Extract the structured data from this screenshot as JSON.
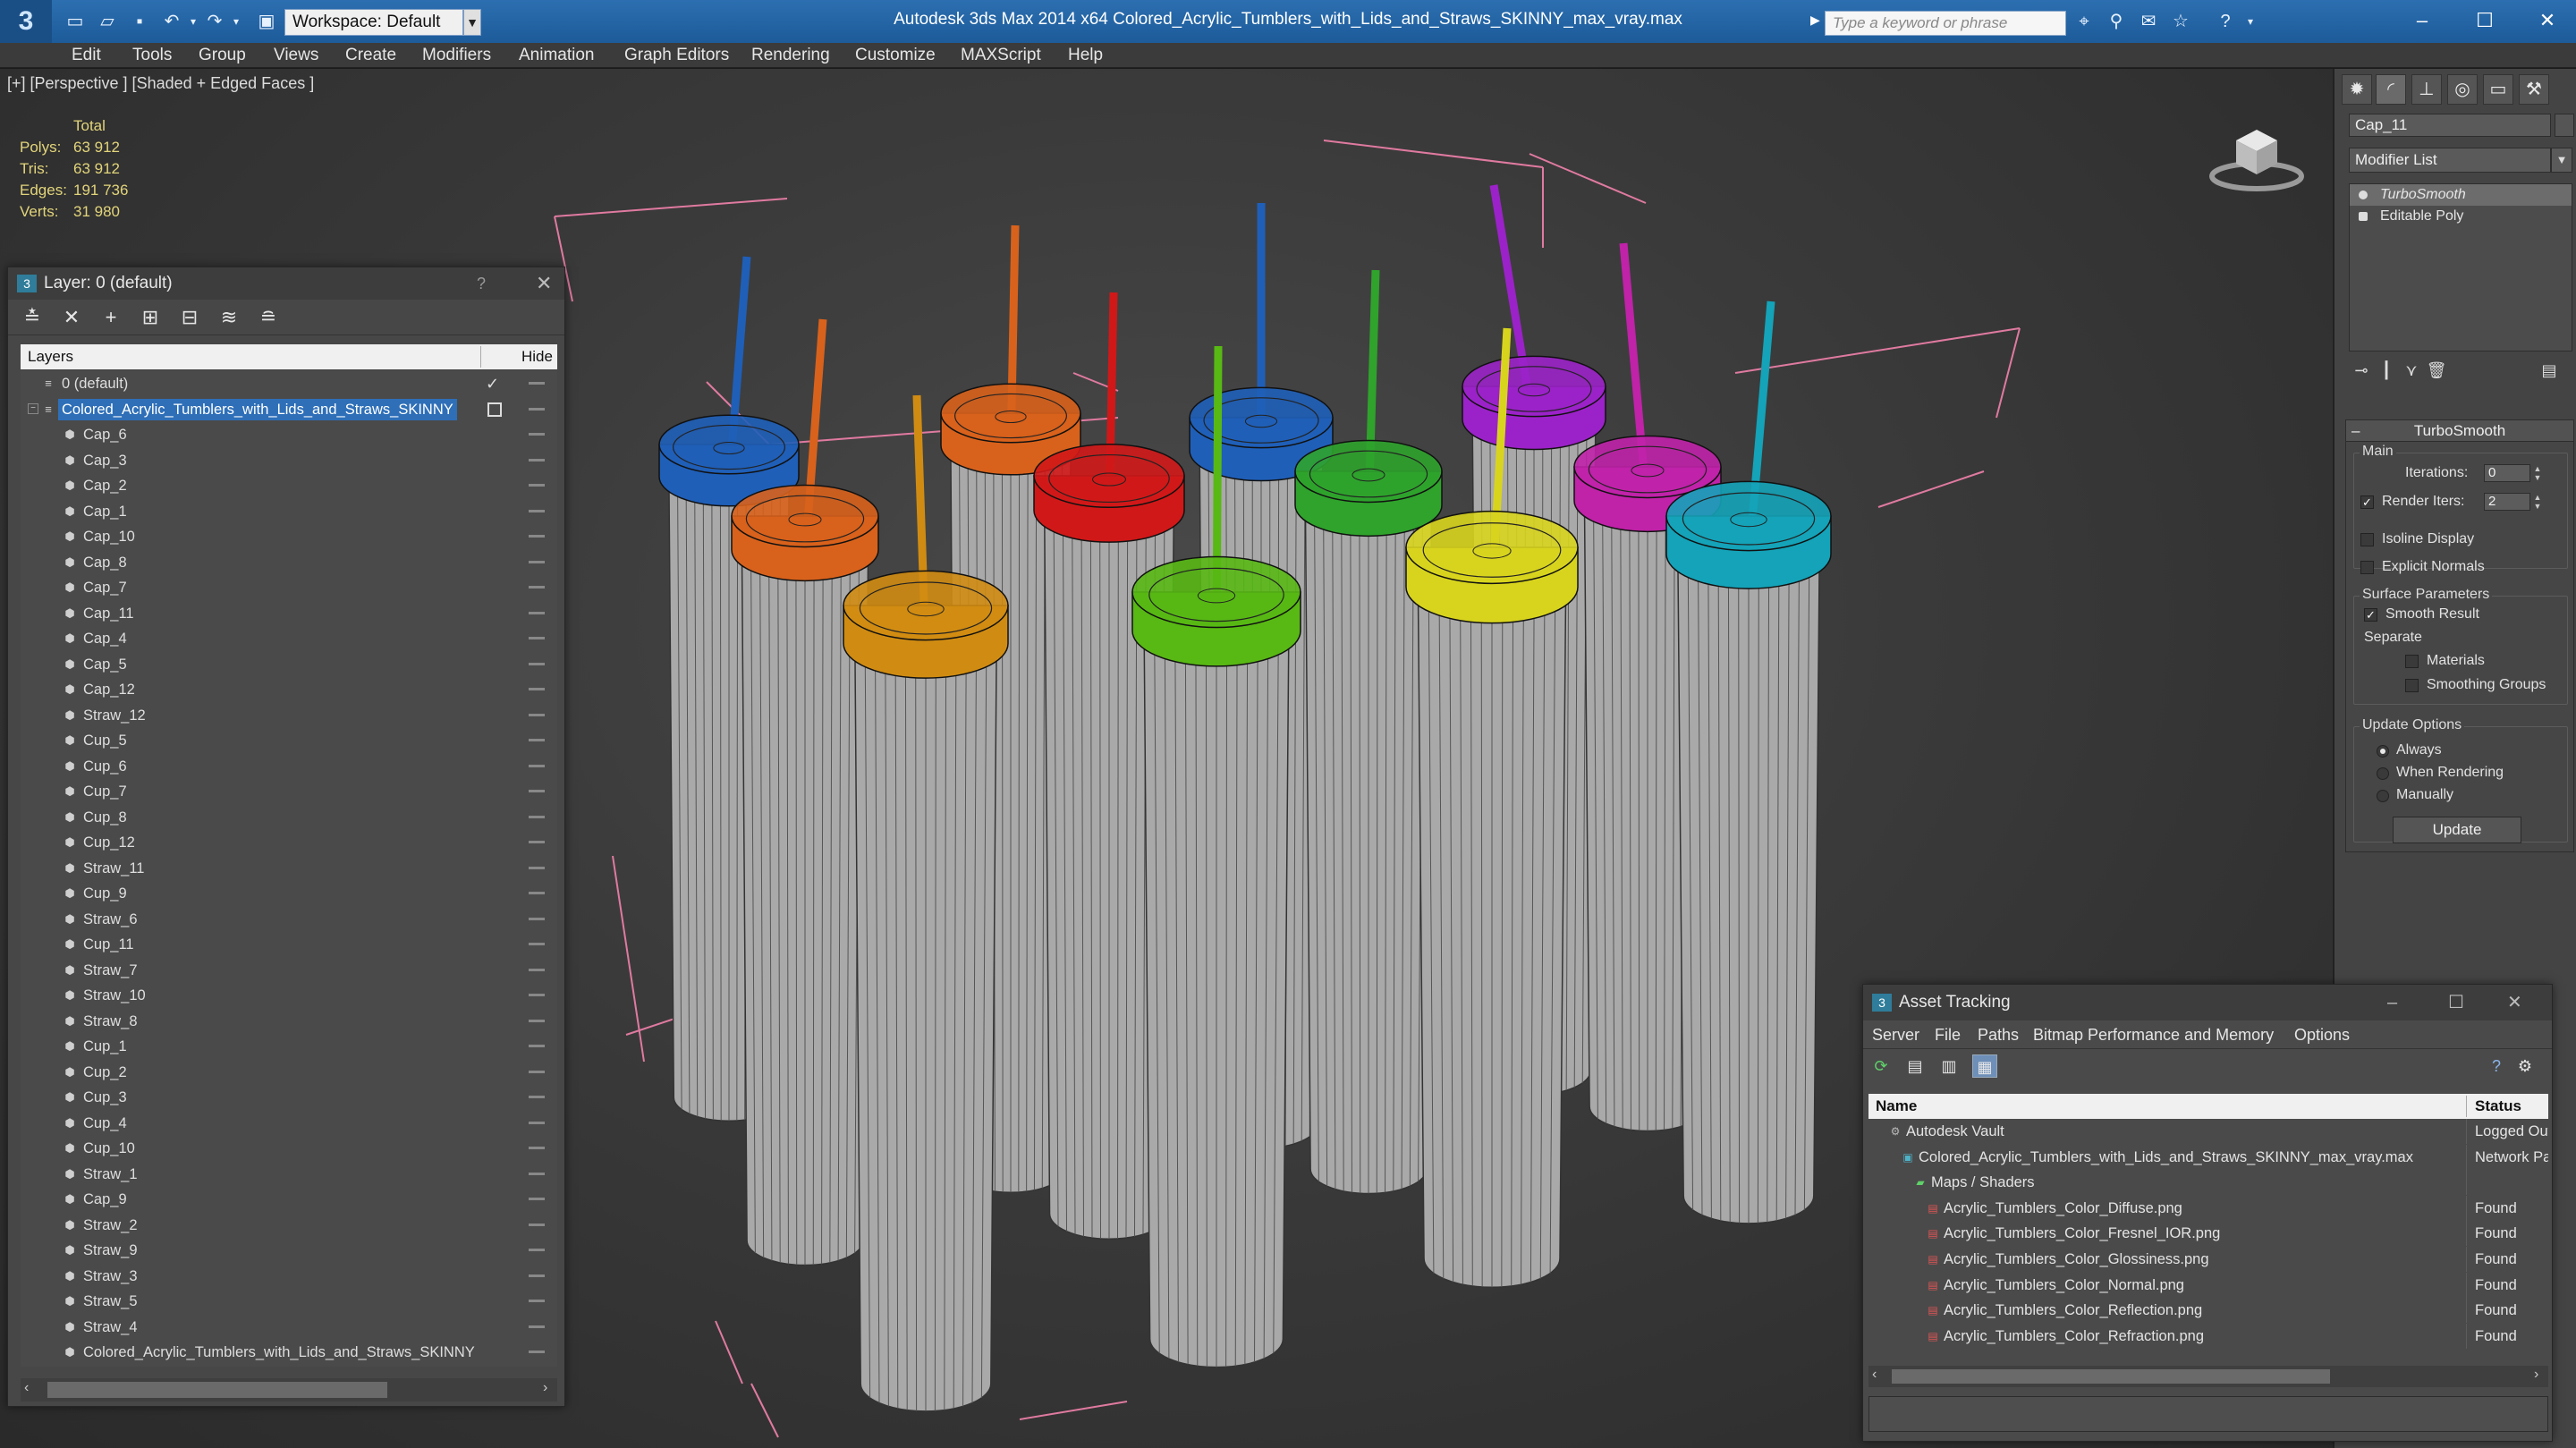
{
  "app": {
    "title": "Autodesk 3ds Max  2014 x64     Colored_Acrylic_Tumblers_with_Lids_and_Straws_SKINNY_max_vray.max",
    "logo_glyph": "3",
    "workspace": "Workspace: Default",
    "search_placeholder": "Type a keyword or phrase"
  },
  "menu": [
    "Edit",
    "Tools",
    "Group",
    "Views",
    "Create",
    "Modifiers",
    "Animation",
    "Graph Editors",
    "Rendering",
    "Customize",
    "MAXScript",
    "Help"
  ],
  "viewport": {
    "label": "[+] [Perspective ] [Shaded + Edged Faces ]",
    "stats": {
      "header": "Total",
      "rows": [
        {
          "label": "Polys:",
          "value": "63 912"
        },
        {
          "label": "Tris:",
          "value": "63 912"
        },
        {
          "label": "Edges:",
          "value": "191 736"
        },
        {
          "label": "Verts:",
          "value": "31 980"
        }
      ]
    }
  },
  "command_panel": {
    "object_name": "Cap_11",
    "modifier_list": "Modifier List",
    "stack": [
      "TurboSmooth",
      "Editable Poly"
    ],
    "rollout_title": "TurboSmooth",
    "main_group": "Main",
    "iterations_label": "Iterations:",
    "iterations_value": "0",
    "render_iters_label": "Render Iters:",
    "render_iters_value": "2",
    "isoline": "Isoline Display",
    "explicit_normals": "Explicit Normals",
    "surface_group": "Surface Parameters",
    "smooth_result": "Smooth Result",
    "separate": "Separate",
    "materials": "Materials",
    "smoothing_groups": "Smoothing Groups",
    "update_group": "Update Options",
    "always": "Always",
    "when_rendering": "When Rendering",
    "manually": "Manually",
    "update_button": "Update"
  },
  "layer_dialog": {
    "title": "Layer: 0 (default)",
    "help": "?",
    "col_layers": "Layers",
    "col_hide": "Hide",
    "layers": [
      {
        "name": "0 (default)",
        "level": 0
      },
      {
        "name": "Colored_Acrylic_Tumblers_with_Lids_and_Straws_SKINNY",
        "level": 0,
        "selected": true
      },
      {
        "name": "Cap_6",
        "level": 1
      },
      {
        "name": "Cap_3",
        "level": 1
      },
      {
        "name": "Cap_2",
        "level": 1
      },
      {
        "name": "Cap_1",
        "level": 1
      },
      {
        "name": "Cap_10",
        "level": 1
      },
      {
        "name": "Cap_8",
        "level": 1
      },
      {
        "name": "Cap_7",
        "level": 1
      },
      {
        "name": "Cap_11",
        "level": 1
      },
      {
        "name": "Cap_4",
        "level": 1
      },
      {
        "name": "Cap_5",
        "level": 1
      },
      {
        "name": "Cap_12",
        "level": 1
      },
      {
        "name": "Straw_12",
        "level": 1
      },
      {
        "name": "Cup_5",
        "level": 1
      },
      {
        "name": "Cup_6",
        "level": 1
      },
      {
        "name": "Cup_7",
        "level": 1
      },
      {
        "name": "Cup_8",
        "level": 1
      },
      {
        "name": "Cup_12",
        "level": 1
      },
      {
        "name": "Straw_11",
        "level": 1
      },
      {
        "name": "Cup_9",
        "level": 1
      },
      {
        "name": "Straw_6",
        "level": 1
      },
      {
        "name": "Cup_11",
        "level": 1
      },
      {
        "name": "Straw_7",
        "level": 1
      },
      {
        "name": "Straw_10",
        "level": 1
      },
      {
        "name": "Straw_8",
        "level": 1
      },
      {
        "name": "Cup_1",
        "level": 1
      },
      {
        "name": "Cup_2",
        "level": 1
      },
      {
        "name": "Cup_3",
        "level": 1
      },
      {
        "name": "Cup_4",
        "level": 1
      },
      {
        "name": "Cup_10",
        "level": 1
      },
      {
        "name": "Straw_1",
        "level": 1
      },
      {
        "name": "Cap_9",
        "level": 1
      },
      {
        "name": "Straw_2",
        "level": 1
      },
      {
        "name": "Straw_9",
        "level": 1
      },
      {
        "name": "Straw_3",
        "level": 1
      },
      {
        "name": "Straw_5",
        "level": 1
      },
      {
        "name": "Straw_4",
        "level": 1
      },
      {
        "name": "Colored_Acrylic_Tumblers_with_Lids_and_Straws_SKINNY",
        "level": 1
      }
    ]
  },
  "asset_dialog": {
    "title": "Asset Tracking",
    "menu": [
      "Server",
      "File",
      "Paths",
      "Bitmap Performance and Memory",
      "Options"
    ],
    "col_name": "Name",
    "col_status": "Status",
    "rows": [
      {
        "name": "Autodesk Vault",
        "status": "Logged Out",
        "level": 0,
        "icon": "vault-icon"
      },
      {
        "name": "Colored_Acrylic_Tumblers_with_Lids_and_Straws_SKINNY_max_vray.max",
        "status": "Network Path",
        "level": 1,
        "icon": "max-file-icon"
      },
      {
        "name": "Maps / Shaders",
        "status": "",
        "level": 2,
        "icon": "maps-icon"
      },
      {
        "name": "Acrylic_Tumblers_Color_Diffuse.png",
        "status": "Found",
        "level": 3,
        "icon": "png-icon"
      },
      {
        "name": "Acrylic_Tumblers_Color_Fresnel_IOR.png",
        "status": "Found",
        "level": 3,
        "icon": "png-icon"
      },
      {
        "name": "Acrylic_Tumblers_Color_Glossiness.png",
        "status": "Found",
        "level": 3,
        "icon": "png-icon"
      },
      {
        "name": "Acrylic_Tumblers_Color_Normal.png",
        "status": "Found",
        "level": 3,
        "icon": "png-icon"
      },
      {
        "name": "Acrylic_Tumblers_Color_Reflection.png",
        "status": "Found",
        "level": 3,
        "icon": "png-icon"
      },
      {
        "name": "Acrylic_Tumblers_Color_Refraction.png",
        "status": "Found",
        "level": 3,
        "icon": "png-icon"
      }
    ]
  },
  "colors": {
    "selection_blue": "#2e6fb8",
    "title_blue": "#2c6fb0",
    "stats_yellow": "#e2d47a",
    "bbox_pink": "#e07aa0",
    "lids": {
      "blue": "#1f5fb8",
      "orange": "#d8621c",
      "red": "#d01818",
      "green": "#2fa32c",
      "purple": "#9b22c8",
      "magenta": "#c022a8",
      "cyan": "#14a3b8",
      "amber": "#d08c12",
      "lime": "#58b814",
      "yellow": "#d8d41e"
    }
  }
}
